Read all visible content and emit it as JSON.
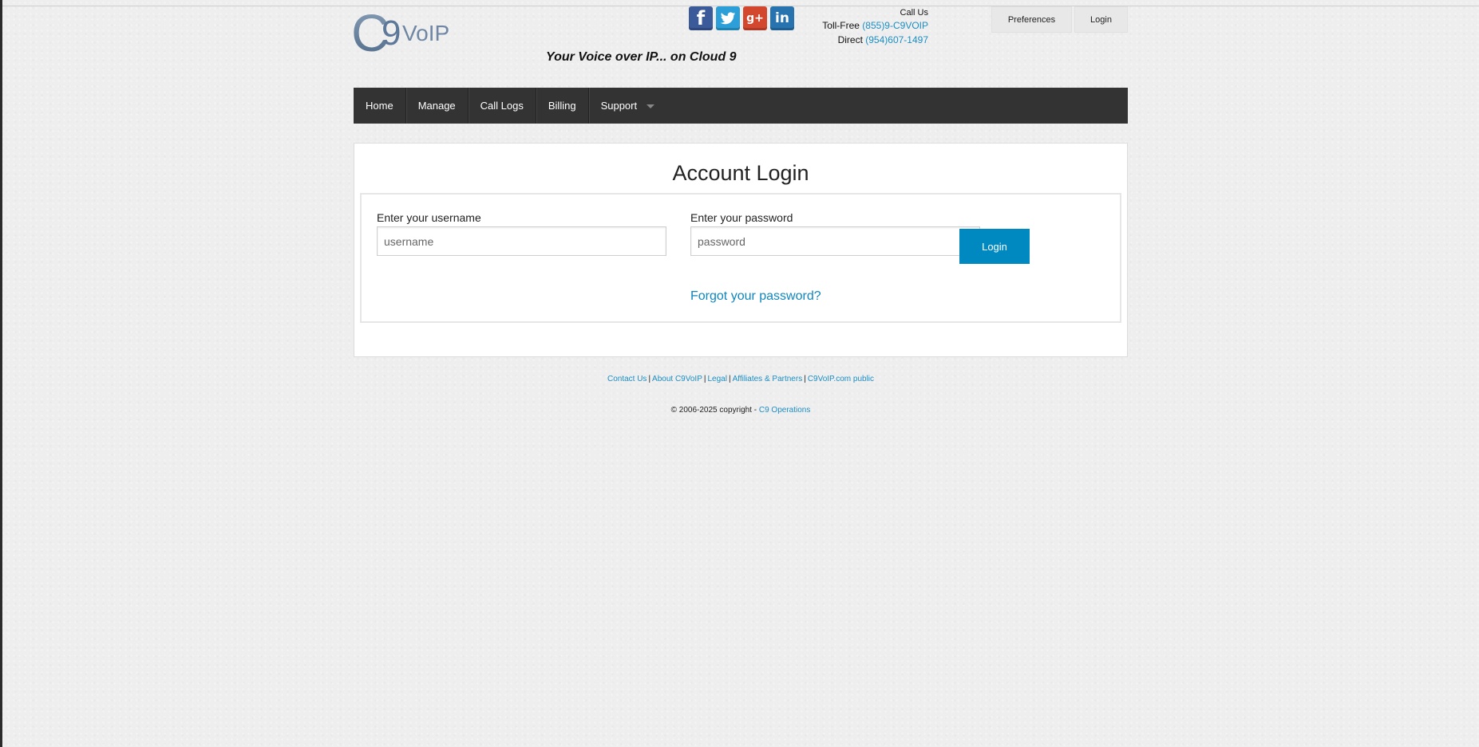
{
  "header": {
    "logo_letter": "C",
    "logo_digit": "9",
    "logo_text": "VoIP",
    "tagline": "Your Voice over IP... on Cloud 9",
    "social": [
      {
        "icon": "facebook-icon",
        "glyph": "f",
        "color": "#3b5a99"
      },
      {
        "icon": "twitter-icon",
        "glyph": "t",
        "color": "#2d9fd8"
      },
      {
        "icon": "google-plus-icon",
        "glyph": "g+",
        "color": "#d4472f"
      },
      {
        "icon": "linkedin-icon",
        "glyph": "in",
        "color": "#2773b0"
      }
    ],
    "contact": {
      "call_us": "Call Us",
      "tollfree_label": "Toll-Free",
      "tollfree_number": "(855)9-C9VOIP",
      "direct_label": "Direct",
      "direct_number": "(954)607-1497"
    },
    "preferences_label": "Preferences",
    "login_label": "Login"
  },
  "nav": {
    "items": [
      {
        "label": "Home"
      },
      {
        "label": "Manage"
      },
      {
        "label": "Call Logs"
      },
      {
        "label": "Billing"
      },
      {
        "label": "Support",
        "has_dropdown": true
      }
    ]
  },
  "login_panel": {
    "title": "Account Login",
    "username_label": "Enter your username",
    "username_placeholder": "username",
    "password_label": "Enter your password",
    "password_placeholder": "password",
    "submit_label": "Login",
    "forgot_link": "Forgot your password?"
  },
  "footer": {
    "links": [
      "Contact Us",
      "About C9VoIP",
      "Legal",
      "Affiliates & Partners",
      "C9VoIP.com public"
    ],
    "separator": "|",
    "copyright_text": "© 2006-2025 copyright -",
    "copyright_link": "C9 Operations"
  },
  "colors": {
    "accent": "#0089c0",
    "link": "#1c8ec3",
    "navbar": "#333333"
  }
}
